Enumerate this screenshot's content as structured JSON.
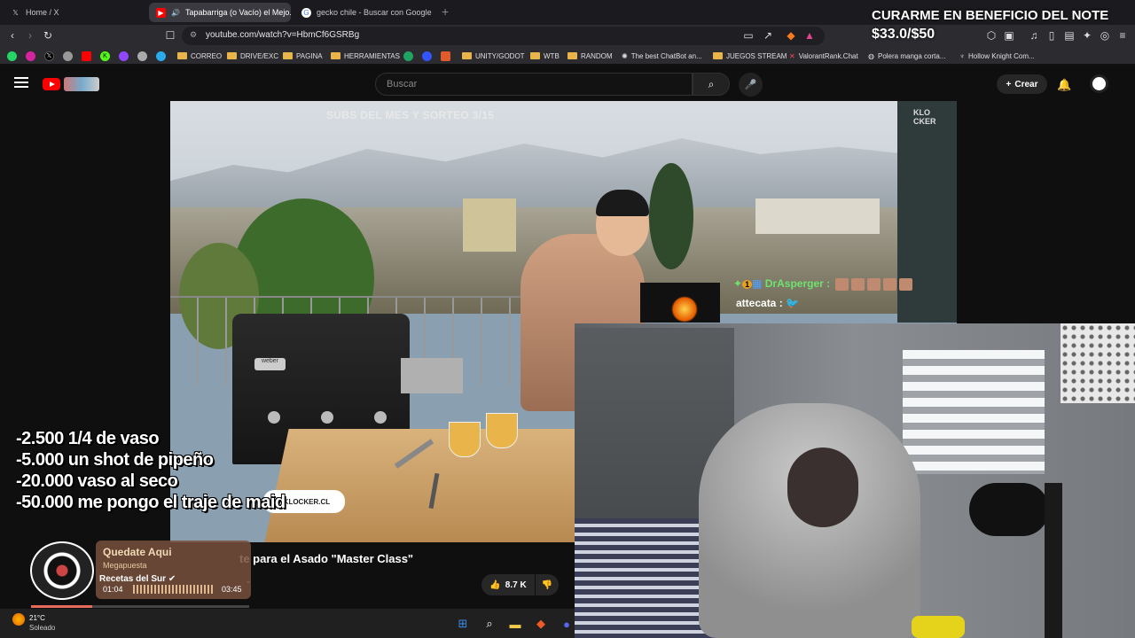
{
  "tabs": [
    {
      "label": "Home / X",
      "icon": "x-icon"
    },
    {
      "label": "Tapabarriga (o Vacío) el Mejo...",
      "icon": "youtube-icon"
    },
    {
      "label": "gecko chile - Buscar con Google",
      "icon": "google-icon"
    }
  ],
  "address": {
    "url": "youtube.com/watch?v=HbmCf6GSRBg"
  },
  "bookmarks": [
    {
      "label": "CORREO"
    },
    {
      "label": "DRIVE/EXC"
    },
    {
      "label": "PAGINA"
    },
    {
      "label": "HERRAMIENTAS"
    },
    {
      "label": "UNITY/GODOT"
    },
    {
      "label": "WTB"
    },
    {
      "label": "RANDOM"
    },
    {
      "label": "The best ChatBot an..."
    },
    {
      "label": "JUEGOS STREAM"
    },
    {
      "label": "ValorantRank.Chat"
    },
    {
      "label": "Polera manga corta..."
    },
    {
      "label": "Hollow Knight Com..."
    }
  ],
  "youtube": {
    "search_placeholder": "Buscar",
    "create_label": "Crear"
  },
  "video": {
    "overlay_subs": "SUBS DEL MES Y SORTEO 3/15",
    "brand_logo": "KLO\nCKER",
    "brand_pill": "NKLOCKER.CL",
    "title": "te para el Asado \"Master Class\"",
    "likes": "8.7 K"
  },
  "chat": [
    {
      "user": "DrAsperger :",
      "badge": "1"
    },
    {
      "user": "attecata :"
    }
  ],
  "donation": {
    "headline": "CURARME EN BENEFICIO DEL NOTE",
    "amount": "$33.0/$50"
  },
  "goals": [
    "-2.500  1/4 de vaso",
    "-5.000 un shot de pipeño",
    "-20.000  vaso al seco",
    "-50.000 me pongo el traje de maid"
  ],
  "music": {
    "title": "Quedate Aqui",
    "artist": "Megapuesta",
    "channel": "Recetas del Sur",
    "time_current": "01:04",
    "time_total": "03:45",
    "progress": 0.28
  },
  "taskbar": {
    "temperature": "21°C",
    "condition": "Soleado"
  },
  "colors": {
    "youtube_red": "#ff0000",
    "chat_green": "#6ee36e",
    "folder": "#e7b54a"
  }
}
